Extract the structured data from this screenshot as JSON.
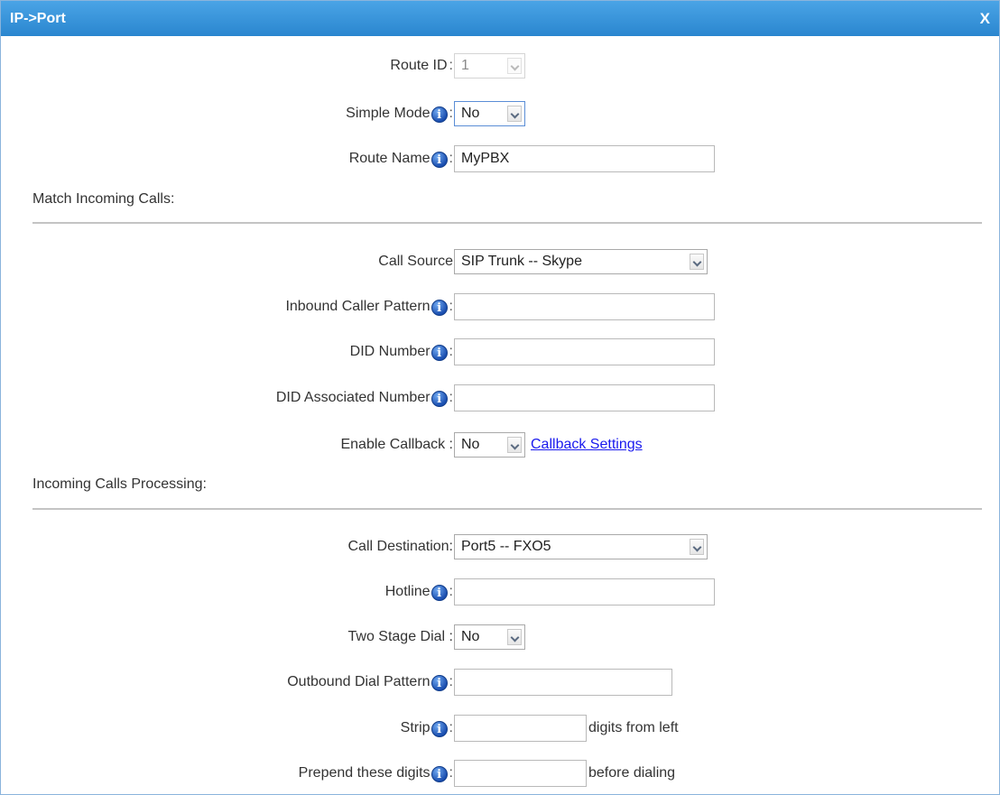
{
  "dialog": {
    "title": "IP->Port",
    "close_label": "X"
  },
  "route_id": {
    "label": "Route ID",
    "colon": ":",
    "value": "1"
  },
  "simple_mode": {
    "label": "Simple Mode",
    "colon": ":",
    "value": "No"
  },
  "route_name": {
    "label": "Route Name",
    "colon": ":",
    "value": "MyPBX"
  },
  "match_section": {
    "title": "Match Incoming Calls:"
  },
  "call_source": {
    "label": "Call Source",
    "value": "SIP Trunk -- Skype"
  },
  "inbound_caller_pattern": {
    "label": "Inbound Caller Pattern",
    "colon": ":",
    "value": ""
  },
  "did_number": {
    "label": "DID Number",
    "colon": ":",
    "value": ""
  },
  "did_associated_number": {
    "label": "DID Associated Number",
    "colon": ":",
    "value": ""
  },
  "enable_callback": {
    "label": "Enable Callback :",
    "value": "No",
    "link": "Callback Settings"
  },
  "processing_section": {
    "title": "Incoming Calls Processing:"
  },
  "call_destination": {
    "label": "Call Destination:",
    "value": "Port5 -- FXO5"
  },
  "hotline": {
    "label": "Hotline",
    "colon": ":",
    "value": ""
  },
  "two_stage_dial": {
    "label": "Two Stage Dial :",
    "value": "No"
  },
  "outbound_dial_pattern": {
    "label": "Outbound Dial Pattern",
    "colon": ":",
    "value": ""
  },
  "strip": {
    "label": "Strip",
    "colon": ":",
    "value": "",
    "suffix": "digits from left"
  },
  "prepend": {
    "label": "Prepend these digits",
    "colon": ":",
    "value": "",
    "suffix": "before dialing"
  },
  "info_icon_glyph": "i",
  "colors": {
    "titlebar": "#2a86cf",
    "link": "#1a1aee",
    "divider": "#c4c4c4"
  }
}
